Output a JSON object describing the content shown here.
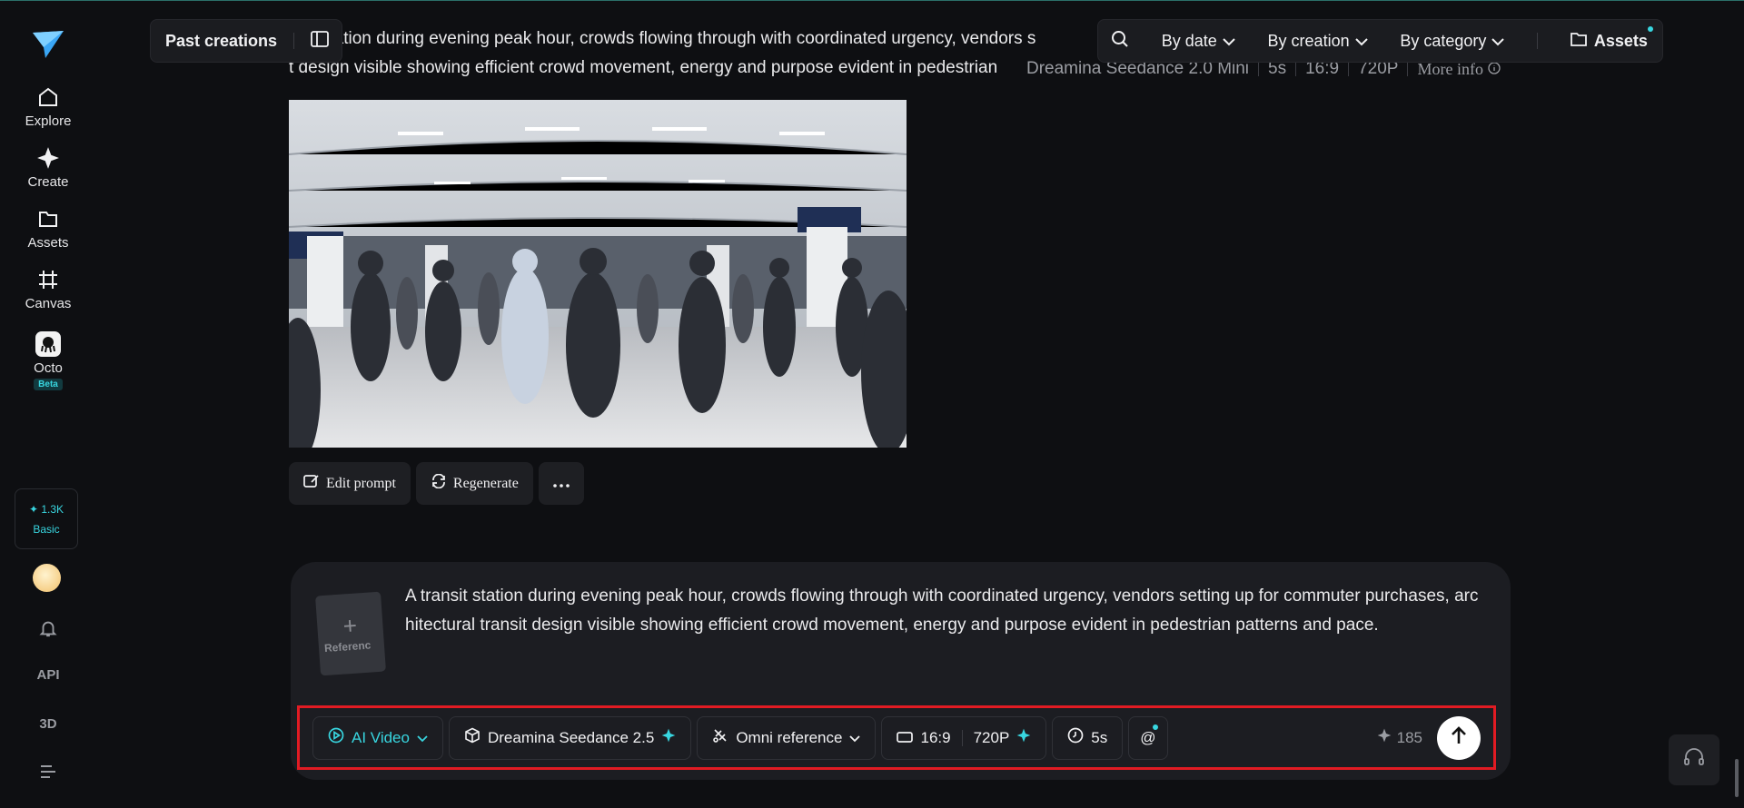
{
  "sidebar": {
    "items": [
      {
        "label": "Explore",
        "icon": "home-icon"
      },
      {
        "label": "Create",
        "icon": "sparkle-icon"
      },
      {
        "label": "Assets",
        "icon": "folder-icon"
      },
      {
        "label": "Canvas",
        "icon": "canvas-icon"
      },
      {
        "label": "Octo",
        "icon": "octo-icon",
        "badge": "Beta"
      }
    ],
    "credits": {
      "amount": "1.3K",
      "tier": "Basic"
    },
    "api_label": "API",
    "three_d_label": "3D"
  },
  "topbar": {
    "past_creations": "Past creations",
    "filters": [
      "By date",
      "By creation",
      "By category"
    ],
    "assets_label": "Assets"
  },
  "creation": {
    "prompt_line1": "nsit station during evening peak hour, crowds flowing through with coordinated urgency, vendors s",
    "prompt_line2": "t design visible showing efficient crowd movement, energy and purpose evident in pedestrian",
    "model": "Dreamina Seedance 2.0 Mini",
    "duration": "5s",
    "ratio": "16:9",
    "resolution": "720P",
    "more_info": "More info"
  },
  "actions": {
    "edit_prompt": "Edit prompt",
    "regenerate": "Regenerate"
  },
  "composer": {
    "reference_label": "Referenc",
    "prompt": "A transit station during evening peak hour, crowds flowing through with coordinated urgency, vendors setting up for commuter purchases, architectural transit design visible showing efficient crowd movement, energy and purpose evident in pedestrian patterns and pace.",
    "mode": "AI Video",
    "model": "Dreamina Seedance 2.5",
    "reference_mode": "Omni reference",
    "ratio": "16:9",
    "resolution": "720P",
    "duration": "5s",
    "mention": "@",
    "cost": "185"
  },
  "colors": {
    "accent": "#38d6e0",
    "highlight_border": "#e11b23"
  }
}
